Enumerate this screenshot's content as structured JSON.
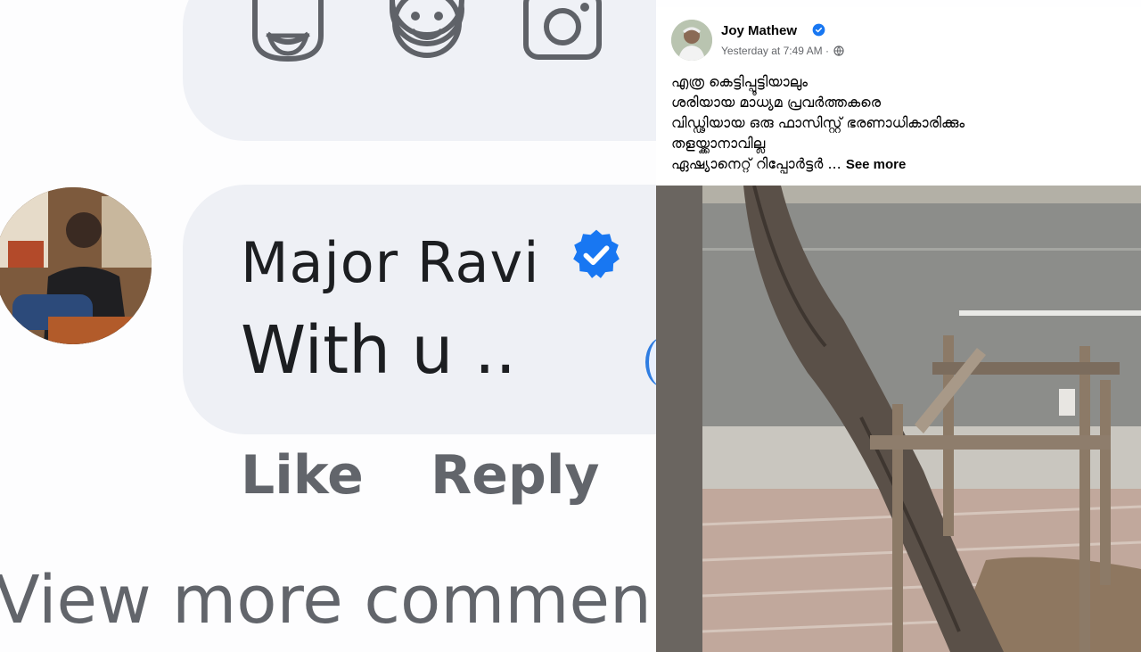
{
  "comment": {
    "author": "Major Ravi",
    "text": "With u ..",
    "actions": {
      "like": "Like",
      "reply": "Reply"
    },
    "view_more": "View more commen"
  },
  "compose": {
    "icons": [
      "sticker-icon",
      "emoji-icon",
      "camera-icon"
    ]
  },
  "post": {
    "author": "Joy Mathew",
    "time": "Yesterday at 7:49 AM ·",
    "lines": [
      "എത്ര കെട്ടിപ്പൂട്ടിയാലും",
      "ശരിയായ മാധ്യമ പ്രവർത്തകരെ",
      "വിഡ്ഢിയായ ഒരു ഫാസിസ്റ്റ് ഭരണാധികാരിക്കും",
      "തളയ്ക്കാനാവില്ല",
      "ഏഷ്യാനെറ്റ് റിപ്പോർട്ടർ ..."
    ],
    "see_more": "See more"
  },
  "colors": {
    "verified": "#1877f2",
    "bubble": "#eef0f5",
    "secondary_text": "#65676b"
  }
}
